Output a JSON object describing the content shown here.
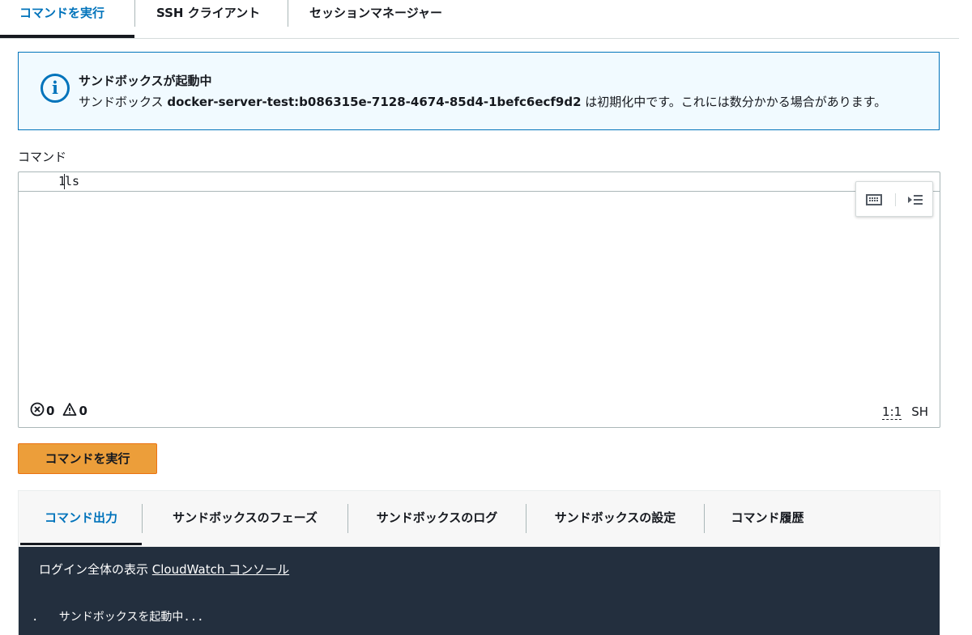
{
  "top_tabs": [
    {
      "label": "コマンドを実行",
      "active": true
    },
    {
      "label": "SSH クライアント",
      "active": false
    },
    {
      "label": "セッションマネージャー",
      "active": false
    }
  ],
  "banner": {
    "icon": "info-icon",
    "title": "サンドボックスが起動中",
    "msg_prefix": "サンドボックス ",
    "sandbox_id": "docker-server-test:b086315e-7128-4674-85d4-1befc6ecf9d2",
    "msg_suffix": " は初期化中です。これには数分かかる場合があります。"
  },
  "command": {
    "label": "コマンド",
    "lines": [
      {
        "number": "1",
        "text": "ls"
      }
    ],
    "errors": "0",
    "warnings": "0",
    "cursor_pos": "1:1",
    "language": "SH"
  },
  "run_button": {
    "label": "コマンドを実行",
    "color": "#ec9e3a"
  },
  "bottom_tabs": [
    {
      "label": "コマンド出力",
      "active": true
    },
    {
      "label": "サンドボックスのフェーズ",
      "active": false
    },
    {
      "label": "サンドボックスのログ",
      "active": false
    },
    {
      "label": "サンドボックスの設定",
      "active": false
    },
    {
      "label": "コマンド履歴",
      "active": false
    }
  ],
  "console": {
    "log_prefix": "ログイン全体の表示 ",
    "log_link": "CloudWatch コンソール",
    "bullet": ".",
    "status_text": "サンドボックスを起動中..."
  },
  "colors": {
    "accent": "#0073bb",
    "console_bg": "#232f3e",
    "banner_bg": "#f1faff"
  }
}
